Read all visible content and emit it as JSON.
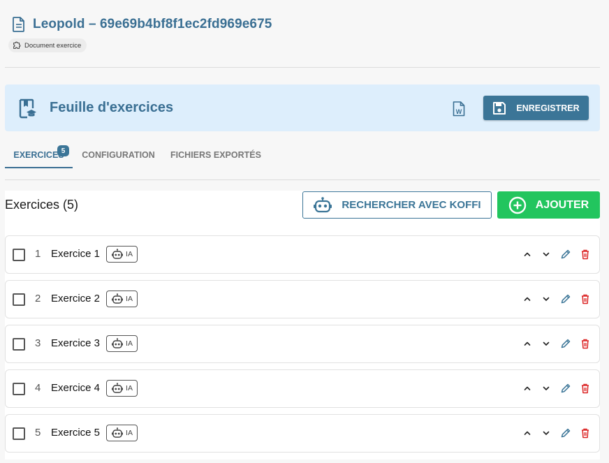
{
  "document": {
    "title": "Leopold – 69e69b4bf8f1ec2fd969e675",
    "chip_label": "Document exercice"
  },
  "banner": {
    "title": "Feuille d'exercices",
    "save_label": "ENREGISTRER"
  },
  "tabs": [
    {
      "label": "EXERCICES",
      "badge": "5",
      "active": true
    },
    {
      "label": "CONFIGURATION",
      "active": false
    },
    {
      "label": "FICHIERS EXPORTÉS",
      "active": false
    }
  ],
  "section": {
    "title": "Exercices (5)",
    "koffi_label": "RECHERCHER AVEC KOFFI",
    "add_label": "AJOUTER"
  },
  "exercises": [
    {
      "num": "1",
      "label": "Exercice 1",
      "badge": "IA"
    },
    {
      "num": "2",
      "label": "Exercice 2",
      "badge": "IA"
    },
    {
      "num": "3",
      "label": "Exercice 3",
      "badge": "IA"
    },
    {
      "num": "4",
      "label": "Exercice 4",
      "badge": "IA"
    },
    {
      "num": "5",
      "label": "Exercice 5",
      "badge": "IA"
    }
  ],
  "colors": {
    "accent": "#3b7597",
    "title_blue": "#3a6f93",
    "banner_bg": "#ddeefc",
    "add_green": "#22c55e",
    "delete_red": "#dc2626"
  },
  "icons": {
    "document": "document-icon",
    "chip": "puzzle-icon",
    "banner": "book-graduation-icon",
    "word": "word-file-icon",
    "save": "floppy-disk-icon",
    "koffi": "robot-icon",
    "add": "plus-circle-icon",
    "row_actions": [
      "chevron-up-icon",
      "chevron-down-icon",
      "pencil-icon",
      "trash-icon"
    ]
  }
}
